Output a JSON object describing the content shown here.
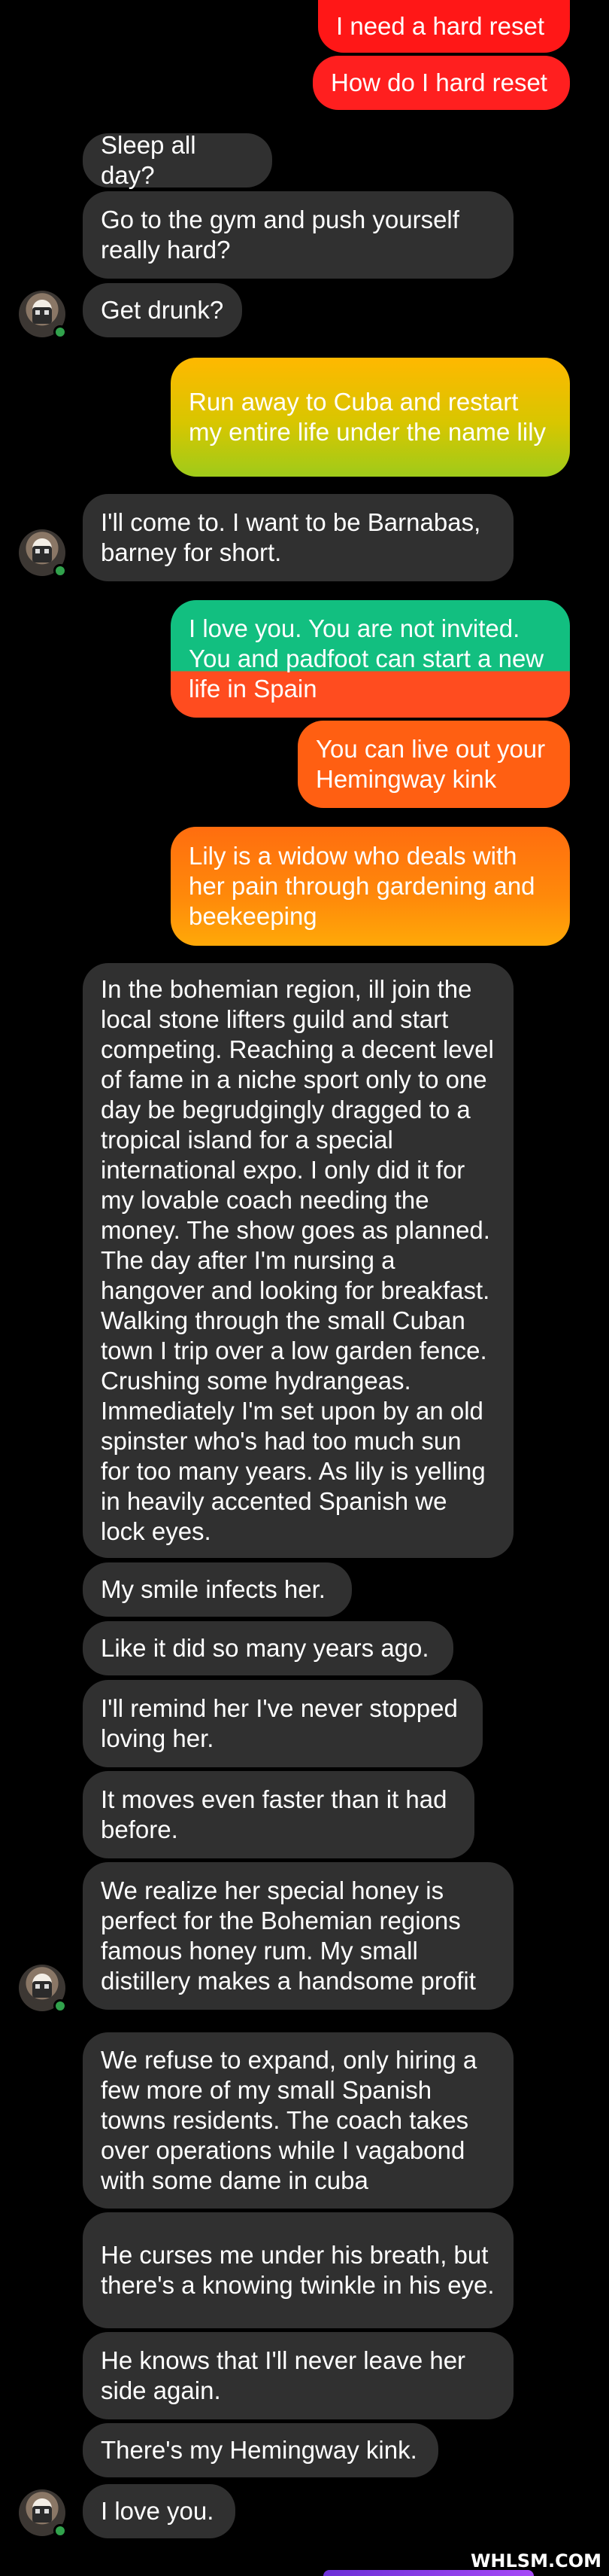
{
  "messages": [
    {
      "side": "me",
      "text": "I need a hard reset"
    },
    {
      "side": "me",
      "text": "How do I hard reset"
    },
    {
      "side": "them",
      "text": "Sleep all day?"
    },
    {
      "side": "them",
      "text": "Go to the gym and push yourself really hard?"
    },
    {
      "side": "them",
      "text": "Get drunk?"
    },
    {
      "side": "me",
      "text": "Run away to Cuba and restart my entire life under the name lily"
    },
    {
      "side": "them",
      "text": "I'll come to. I want to be Barnabas, barney for short."
    },
    {
      "side": "me",
      "text": "I love you. You are not invited. You and padfoot can start a new life in Spain"
    },
    {
      "side": "me",
      "text": "You can live out your Hemingway kink"
    },
    {
      "side": "me",
      "text": "Lily is a widow who deals with her pain through gardening and beekeeping"
    },
    {
      "side": "them",
      "text": "In the bohemian region, ill join the local stone lifters guild and start competing. Reaching a decent level of fame in a niche sport only to one day be begrudgingly dragged to a tropical island for a special international expo. I only did it for my lovable coach needing the money. The show goes as planned. The day after I'm nursing a hangover and looking for breakfast. Walking through the small Cuban town I trip over a low garden fence. Crushing some hydrangeas. Immediately I'm set upon by an old spinster who's had too much sun for too many years. As lily is yelling in heavily accented Spanish we lock eyes."
    },
    {
      "side": "them",
      "text": "My smile infects her."
    },
    {
      "side": "them",
      "text": "Like it did so many years ago."
    },
    {
      "side": "them",
      "text": "I'll remind her I've never stopped loving her."
    },
    {
      "side": "them",
      "text": "It moves even faster than it had before."
    },
    {
      "side": "them",
      "text": "We realize her special honey is perfect for the Bohemian regions famous honey rum. My small distillery makes a handsome profit"
    },
    {
      "side": "them",
      "text": "We refuse to expand, only hiring a few more of my small Spanish towns residents. The coach takes over operations while I vagabond with some dame in cuba"
    },
    {
      "side": "them",
      "text": "He curses me under his breath, but there's a knowing twinkle in his eye."
    },
    {
      "side": "them",
      "text": "He knows that I'll never leave her side again."
    },
    {
      "side": "them",
      "text": "There's my Hemingway kink."
    },
    {
      "side": "them",
      "text": "I love you."
    }
  ],
  "watermark": "WHLSM.COM",
  "colors": {
    "them_bubble": "#303030",
    "red": "#ff1f1f",
    "online": "#31a24c"
  },
  "avatar_icon": "contact-avatar"
}
